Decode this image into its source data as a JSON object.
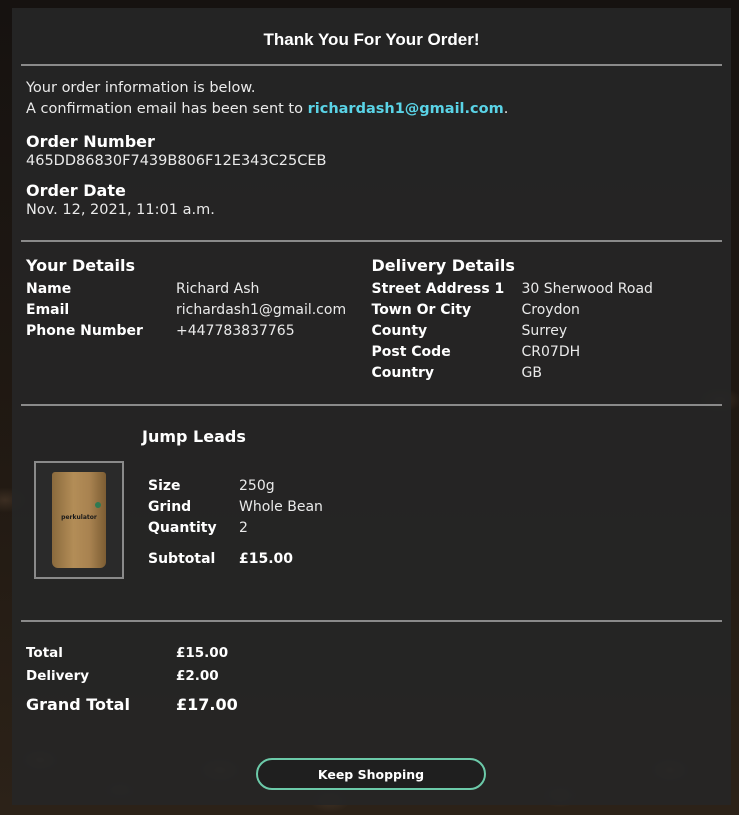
{
  "title": "Thank You For Your Order!",
  "intro": {
    "line1": "Your order information is below.",
    "line2_prefix": "A confirmation email has been sent to ",
    "email": "richardash1@gmail.com",
    "line2_suffix": "."
  },
  "order_number": {
    "label": "Order Number",
    "value": "465DD86830F7439B806F12E343C25CEB"
  },
  "order_date": {
    "label": "Order Date",
    "value": "Nov. 12, 2021, 11:01 a.m."
  },
  "your_details": {
    "heading": "Your Details",
    "rows": [
      {
        "label": "Name",
        "value": "Richard Ash"
      },
      {
        "label": "Email",
        "value": "richardash1@gmail.com"
      },
      {
        "label": "Phone Number",
        "value": "+447783837765"
      }
    ]
  },
  "delivery_details": {
    "heading": "Delivery Details",
    "rows": [
      {
        "label": "Street Address 1",
        "value": "30 Sherwood Road"
      },
      {
        "label": "Town Or City",
        "value": "Croydon"
      },
      {
        "label": "County",
        "value": "Surrey"
      },
      {
        "label": "Post Code",
        "value": "CR07DH"
      },
      {
        "label": "Country",
        "value": "GB"
      }
    ]
  },
  "item": {
    "name": "Jump Leads",
    "image_text": "perkulator",
    "rows": [
      {
        "label": "Size",
        "value": "250g"
      },
      {
        "label": "Grind",
        "value": "Whole Bean"
      },
      {
        "label": "Quantity",
        "value": "2"
      }
    ],
    "subtotal_label": "Subtotal",
    "subtotal_value": "£15.00"
  },
  "totals": {
    "total_label": "Total",
    "total_value": "£15.00",
    "delivery_label": "Delivery",
    "delivery_value": "£2.00",
    "grand_label": "Grand Total",
    "grand_value": "£17.00"
  },
  "keep_shopping_label": "Keep Shopping",
  "colors": {
    "accent_link": "#5ad3e6",
    "button_border": "#6ccaa9"
  }
}
